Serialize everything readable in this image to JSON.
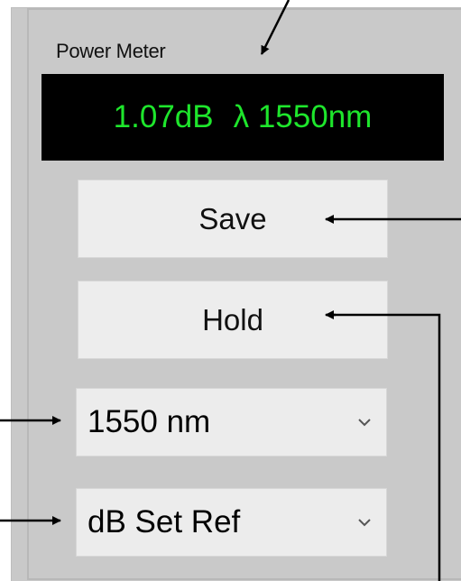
{
  "power_meter": {
    "title": "Power Meter",
    "readout": {
      "power": "1.07dB",
      "wavelength": "λ 1550nm"
    },
    "buttons": {
      "save_label": "Save",
      "hold_label": "Hold"
    },
    "wavelength_select": {
      "selected": "1550 nm",
      "icon": "chevron-down-icon"
    },
    "mode_select": {
      "selected": "dB Set Ref",
      "icon": "chevron-down-icon"
    }
  },
  "colors": {
    "panel_bg": "#c9c9c9",
    "display_bg": "#000000",
    "display_text": "#1ee62c",
    "button_bg": "#ededed",
    "annotation": "#000000"
  }
}
